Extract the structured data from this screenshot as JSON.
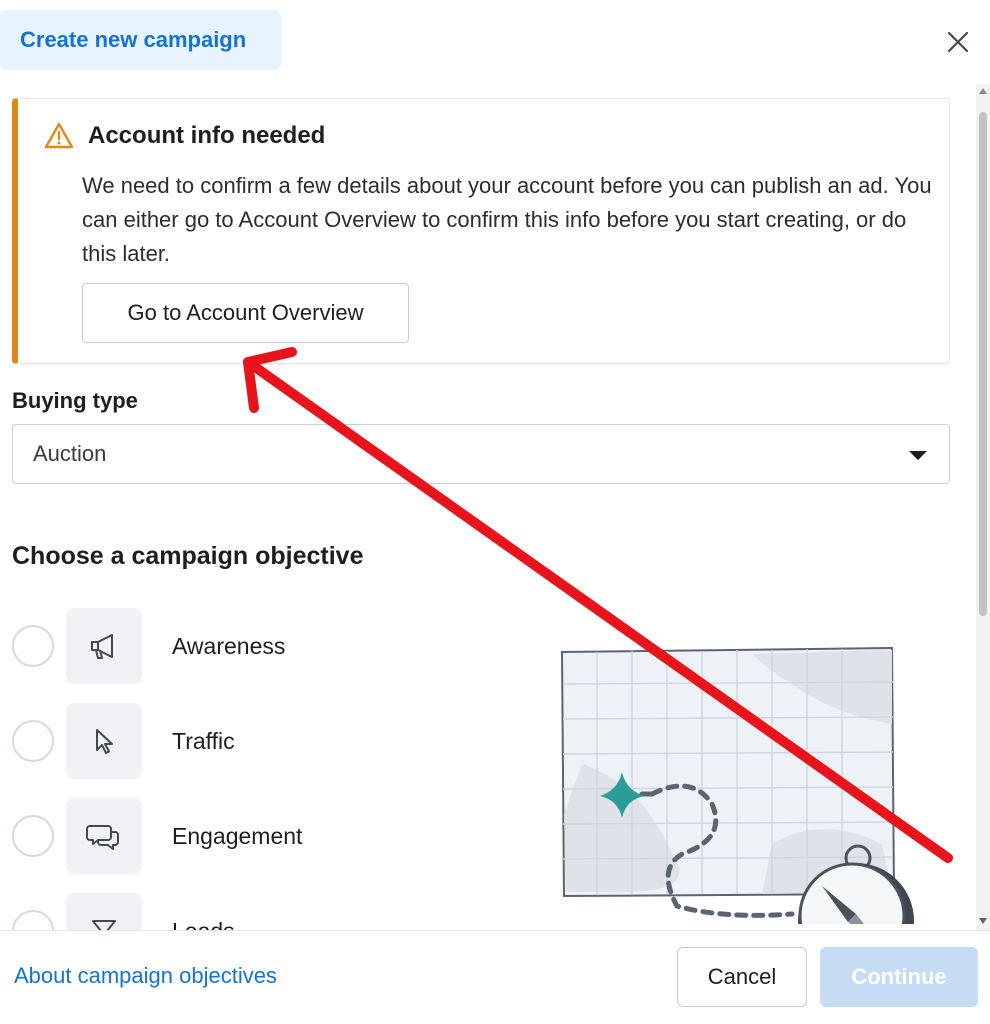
{
  "header": {
    "title": "Create new campaign",
    "close_icon": "close-icon"
  },
  "notice": {
    "icon": "warning-triangle-icon",
    "title": "Account info needed",
    "body": "We need to confirm a few details about your account before you can publish an ad. You can either go to Account Overview to confirm this info before you start creating, or do this later.",
    "button_label": "Go to Account Overview",
    "accent_color": "#e0881a"
  },
  "buying_type": {
    "label": "Buying type",
    "selected": "Auction"
  },
  "objectives": {
    "heading": "Choose a campaign objective",
    "items": [
      {
        "label": "Awareness",
        "icon": "megaphone-icon"
      },
      {
        "label": "Traffic",
        "icon": "cursor-icon"
      },
      {
        "label": "Engagement",
        "icon": "chat-bubbles-icon"
      },
      {
        "label": "Leads",
        "icon": "funnel-icon"
      }
    ]
  },
  "footer": {
    "about_link": "About campaign objectives",
    "cancel_label": "Cancel",
    "continue_label": "Continue"
  },
  "colors": {
    "link": "#1672d6",
    "title_chip_bg": "#e7f3ff",
    "continue_disabled_bg": "#c5dcf5",
    "annotation_arrow": "#e8141c",
    "illustration_teal": "#2a9d98"
  }
}
